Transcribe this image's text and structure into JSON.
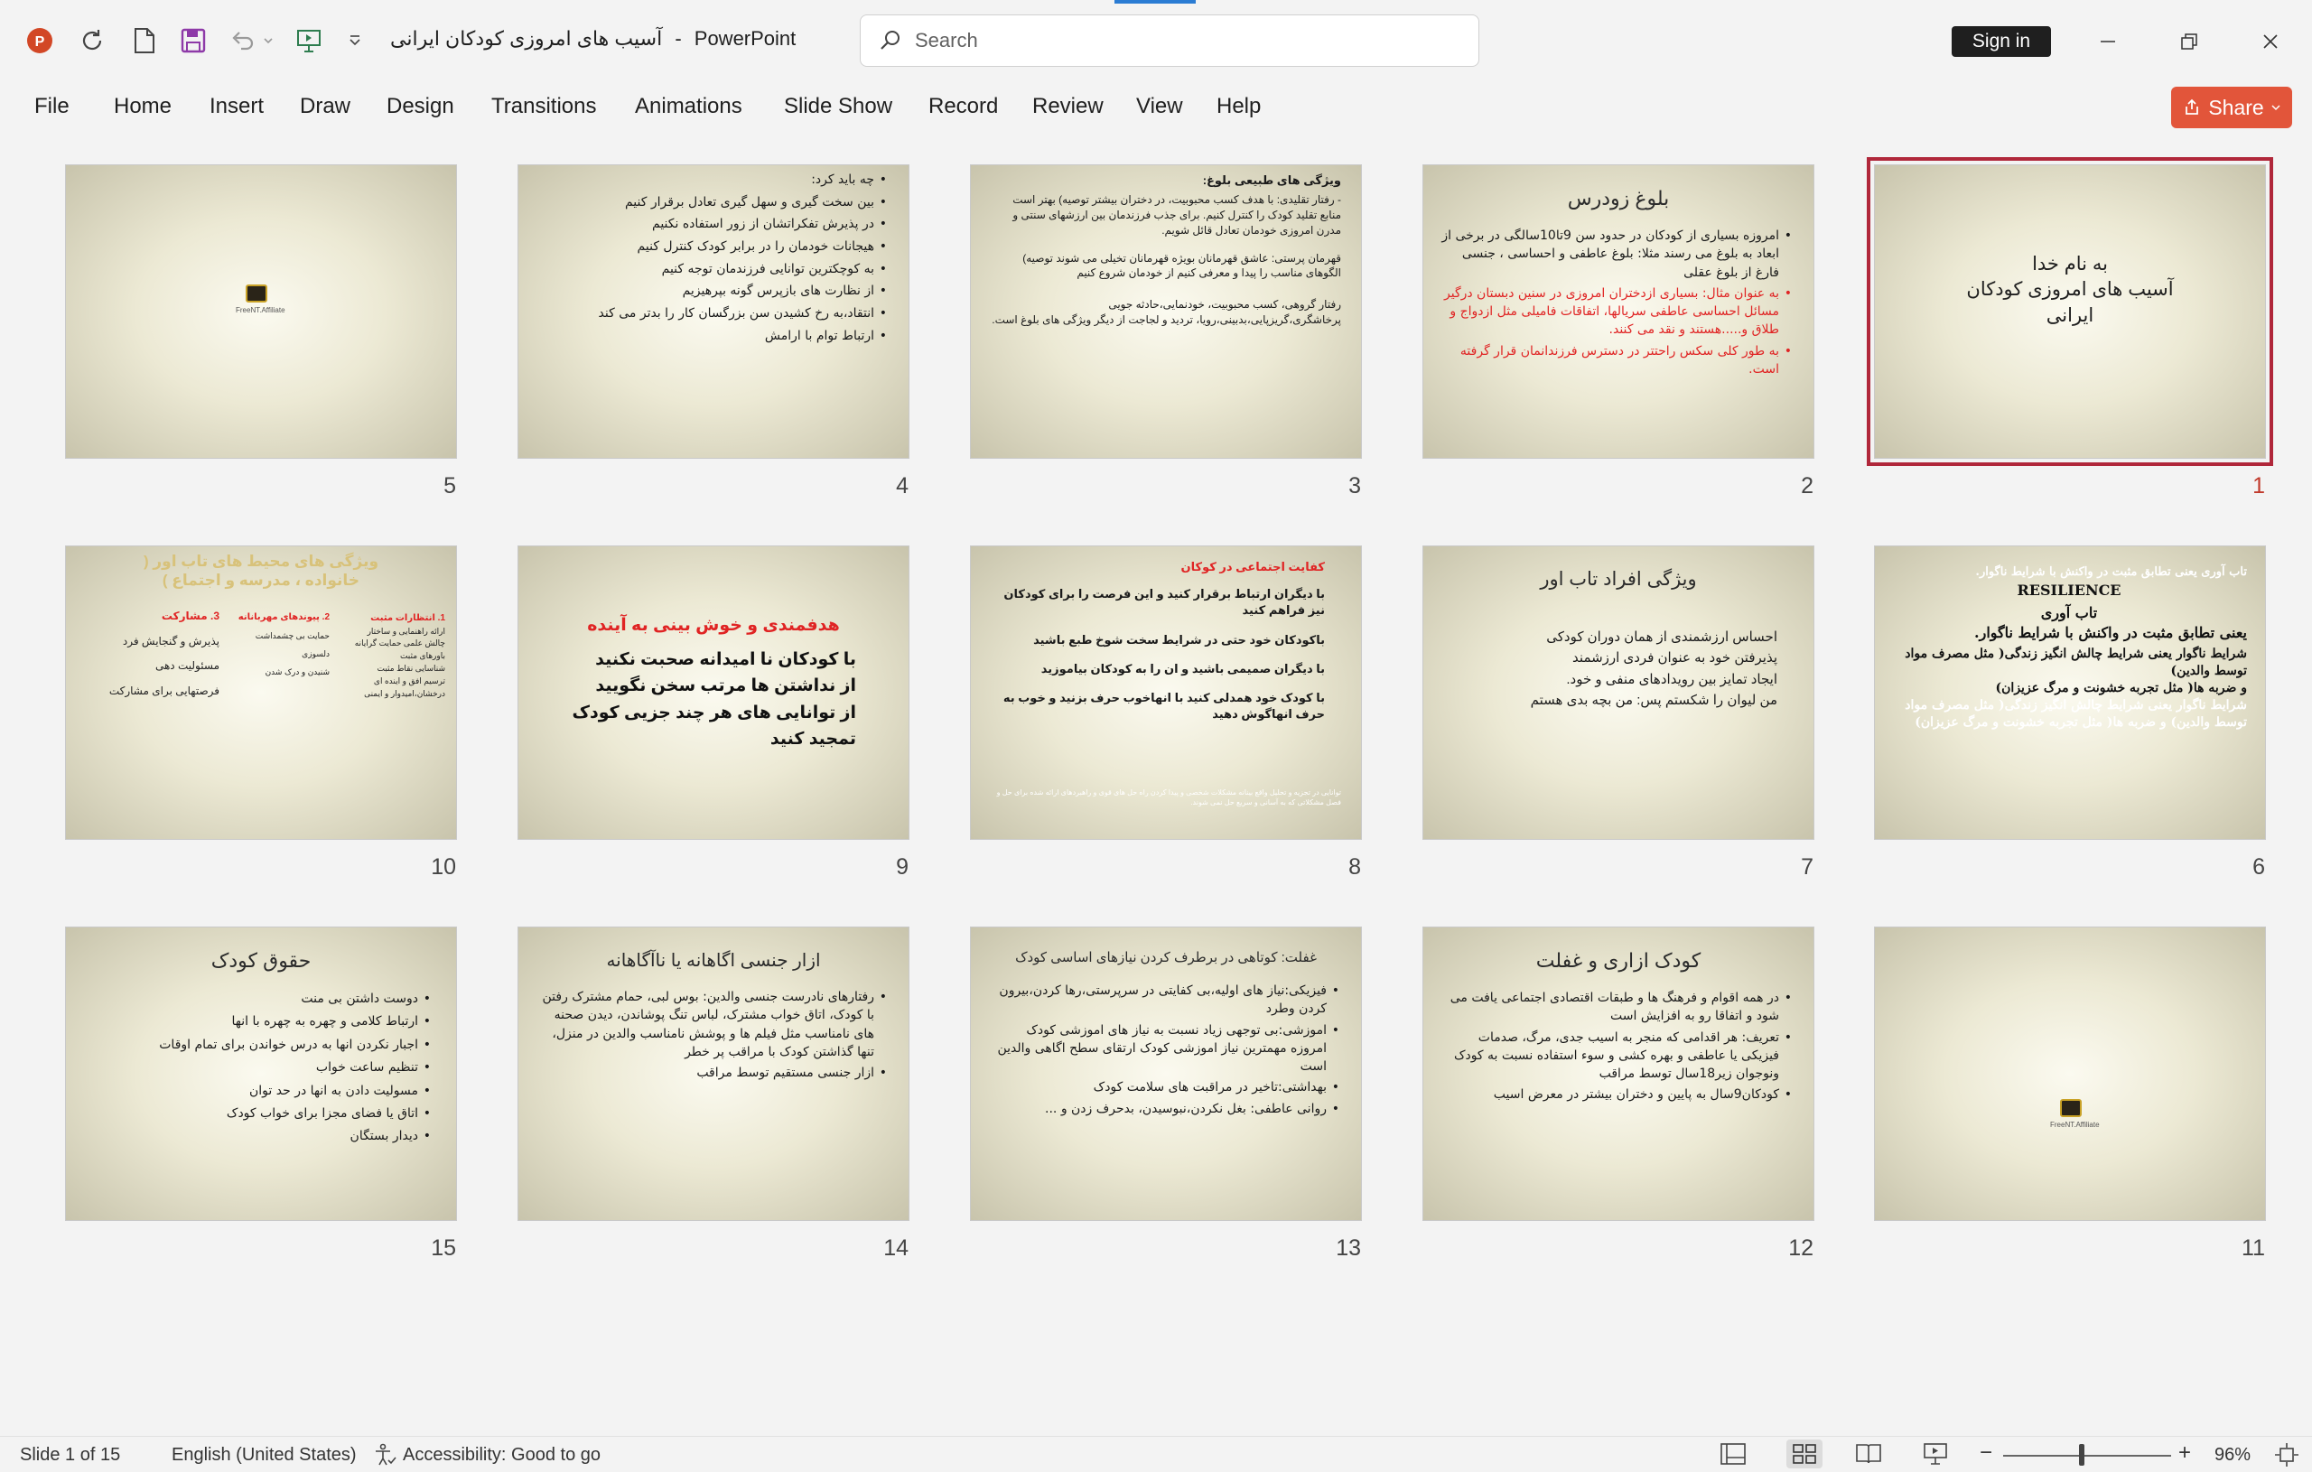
{
  "app": {
    "document_title": "آسیب های امروزی کودکان ایرانی",
    "separator": "-",
    "app_name": "PowerPoint",
    "search_placeholder": "Search",
    "sign_in_label": "Sign in",
    "share_label": "Share"
  },
  "ribbon_tabs": [
    "File",
    "Home",
    "Insert",
    "Draw",
    "Design",
    "Transitions",
    "Animations",
    "Slide Show",
    "Record",
    "Review",
    "View",
    "Help"
  ],
  "slides": {
    "s1": {
      "number": "1",
      "lines": [
        "به نام خدا",
        "آسیب های امروزی کودکان",
        "ایرانی"
      ]
    },
    "s2": {
      "number": "2",
      "title": "بلوغ زودرس",
      "bullets": [
        "امروزه بسیاری از کودکان در حدود سن 9تا10سالگی در برخی از ابعاد به بلوغ می رسند مثلا: بلوغ عاطفی و احساسی ، جنسی فارغ از بلوغ عقلی",
        "به عنوان مثال: بسیاری ازدختران امروزی در سنین دبستان درگیر مسائل احساسی عاطفی سریالها، اتفاقات فامیلی مثل ازدواج و طلاق و.....هستند و نقد می کنند.",
        "به طور کلی سکس راحتتر در دسترس فرزندانمان قرار گرفته است."
      ]
    },
    "s3": {
      "number": "3",
      "heading": "ویژگی های طبیعی بلوغ:",
      "p1": "- رفتار تقلیدی: با هدف کسب محبوبیت، در دختران بیشتر توصیه) بهتر است منابع تقلید کودک را کنترل کنیم. برای جذب فرزندمان بین ارزشهای سنتی و مدرن امروزی خودمان تعادل قائل شویم.",
      "p2": "قهرمان پرستی: عاشق قهرمانان بویژه قهرمانان تخیلی می شوند توصیه) الگوهای مناسب را پیدا و معرفی کنیم از خودمان شروع کنیم",
      "p3": "رفتار گروهی، کسب محبوبیت، خودنمایی،حادثه جویی پرخاشگری،گریزپایی،بدبینی،رویا، تردید و لجاجت از دیگر ویژگی های بلوغ است."
    },
    "s4": {
      "number": "4",
      "bullets": [
        "چه باید کرد:",
        "بین سخت گیری و سهل گیری تعادل برقرار کنیم",
        "در پذیرش تفکراتشان از زور استفاده نکنیم",
        "هیجانات خودمان را در برابر کودک کنترل کنیم",
        "به کوچکترین توانایی فرزندمان توجه کنیم",
        "از نظارت های بازپرس گونه بپرهیزیم",
        "انتقاد،به رخ کشیدن سن بزرگسان کار را بدتر می کند",
        "ارتباط توام با ارامش"
      ]
    },
    "s5": {
      "number": "5",
      "logo_caption": "FreeNT.Affiliate"
    },
    "s6": {
      "number": "6",
      "lines": [
        "تاب آوری یعنی تطابق مثبت در واکنش با شرایط ناگوار.",
        "RESILIENCE",
        "تاب آوری",
        "یعنی تطابق مثبت در واکنش با شرایط ناگوار.",
        "شرایط ناگوار یعنی شرایط چالش انگیز زندگی( مثل مصرف مواد توسط والدین)",
        "و ضربه ها( مثل تجربه خشونت و مرگ عزیزان)",
        "شرایط ناگوار یعنی شرایط چالش انگیز زندگی( مثل مصرف مواد توسط والدین) و ضربه ها( مثل تجربه خشونت و مرگ عزیزان)"
      ]
    },
    "s7": {
      "number": "7",
      "title": "ویژگی افراد تاب اور",
      "lines": [
        "احساس ارزشمندی از همان دوران کودکی",
        "پذیرفتن خود به عنوان فردی ارزشمند",
        "ایجاد تمایز بین رویدادهای منفی و خود.",
        "من لیوان را شکستم پس: من بچه بدی هستم"
      ]
    },
    "s8": {
      "number": "8",
      "heading": "کفایت اجتماعی در کوکان",
      "bullets": [
        "با دیگران ارتباط برقرار کنید و این فرصت را برای کودکان نیز فراهم کنید",
        "باکودکان خود حتی در شرایط سخت شوخ طبع باشید",
        "با دیگران صمیمی باشید و ان را به کودکان بیاموزید",
        "با کودک خود همدلی کنید با انهاخوب حرف بزنید و خوب به حرف انهاگوش دهید"
      ],
      "footnote": "توانایی در تجزیه و تحلیل واقع بینانه مشکلات شخصی و پیدا کردن راه حل های قوی و راهبردهای ارائه شده برای حل و فصل مشکلاتی که به آسانی و سریع حل نمی شوند."
    },
    "s9": {
      "number": "9",
      "title": "هدفمندی و خوش بینی به آینده",
      "bullets": [
        "با کودکان نا امیدانه صحبت نکنید",
        "از نداشتن ها مرتب سخن نگویید",
        "از توانایی های هر چند جزیی کودک تمجید کنید"
      ]
    },
    "s10": {
      "number": "10",
      "title": "ویژگی های محیط های تاب اور ( خانواده ، مدرسه و اجتماع )",
      "col1_head": "1. انتظارات مثبت",
      "col1": [
        "ارائه راهنمایی و ساختار",
        "چالش علمی حمایت گرایانه",
        "باورهای مثبت",
        "شناسایی نقاط مثبت",
        "ترسیم افق و اینده ای درخشان،امیدوار و ایمنی"
      ],
      "col2_head": "2. پیوندهای مهربانانه",
      "col2": [
        "حمایت بی چشمداشت",
        "دلسوزی",
        "شنیدن و درک شدن"
      ],
      "col3_head": "3. مشارکت",
      "col3": [
        "پذیرش و گنجایش فرد",
        "مسئولیت دهی",
        "فرصتهایی برای مشارکت"
      ]
    },
    "s11": {
      "number": "11",
      "logo_caption": "FreeNT.Affiliate"
    },
    "s12": {
      "number": "12",
      "title": "کودک ازاری و غفلت",
      "bullets": [
        "در همه اقوام و فرهنگ ها و طبقات اقتصادی اجتماعی یافت می شود و اتفاقا رو به افزایش است",
        "تعریف: هر اقدامی که منجر به اسیب جدی، مرگ، صدمات فیزیکی یا عاطفی و بهره کشی و سوء استفاده نسبت به کودک ونوجوان زیر18سال توسط مراقب",
        "کودکان9سال به پایین و دختران بیشتر در معرض اسیب"
      ]
    },
    "s13": {
      "number": "13",
      "title": "غفلت: کوتاهی در برطرف کردن نیازهای اساسی کودک",
      "bullets": [
        "فیزیکی:نیاز های اولیه،بی کفایتی در سرپرستی،رها کردن،بیرون کردن وطرد",
        "اموزشی:بی توجهی زیاد نسبت به نیاز های اموزشی کودک امروزه مهمترین نیاز اموزشی کودک ارتقای سطح اگاهی والدین است",
        "بهداشتی:تاخیر در مراقبت های سلامت کودک",
        "روانی عاطفی: بغل نکردن،نبوسیدن، بدحرف زدن و ..."
      ]
    },
    "s14": {
      "number": "14",
      "title": "ازار جنسی اگاهانه یا ناآگاهانه",
      "bullets": [
        "رفتارهای نادرست جنسی والدین: بوس لبی، حمام مشترک رفتن با کودک، اتاق خواب مشترک، لباس تنگ پوشاندن، دیدن صحنه های نامناسب مثل فیلم ها و پوشش نامناسب والدین در منزل، تنها گذاشتن کودک با مراقب پر خطر",
        "ازار جنسی مستقیم توسط مراقب"
      ]
    },
    "s15": {
      "number": "15",
      "title": "حقوق کودک",
      "bullets": [
        "دوست داشتن بی منت",
        "ارتباط کلامی و چهره به چهره با انها",
        "اجبار نکردن انها به درس خواندن برای تمام اوقات",
        "تنظیم ساعت خواب",
        "مسولیت دادن به انها در حد توان",
        "اتاق یا فضای مجزا برای خواب کودک",
        "دیدار بستگان"
      ]
    }
  },
  "statusbar": {
    "slide_info": "Slide 1 of 15",
    "language": "English (United States)",
    "accessibility": "Accessibility: Good to go",
    "zoom": "96%"
  },
  "colors": {
    "accent_red": "#b0273a",
    "share": "#e2553a",
    "text_red": "#e02424"
  }
}
